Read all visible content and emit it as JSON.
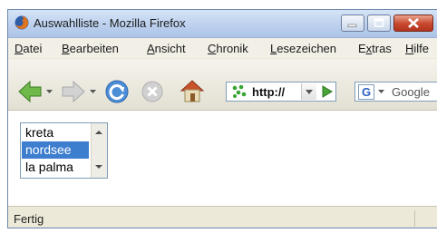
{
  "window": {
    "title": "Auswahlliste - Mozilla Firefox"
  },
  "menu": {
    "items": [
      {
        "pre": "",
        "acc": "D",
        "post": "atei"
      },
      {
        "pre": "",
        "acc": "B",
        "post": "earbeiten"
      },
      {
        "pre": "",
        "acc": "A",
        "post": "nsicht"
      },
      {
        "pre": "",
        "acc": "C",
        "post": "hronik"
      },
      {
        "pre": "",
        "acc": "L",
        "post": "esezeichen"
      },
      {
        "pre": "E",
        "acc": "x",
        "post": "tras"
      },
      {
        "pre": "",
        "acc": "H",
        "post": "ilfe"
      }
    ]
  },
  "toolbar": {
    "url_text": "http://",
    "search_placeholder": "Google"
  },
  "listbox": {
    "options": [
      "kreta",
      "nordsee",
      "la palma"
    ],
    "selected_index": 1
  },
  "status": {
    "text": "Fertig"
  },
  "icons": {
    "title": "firefox-icon",
    "back": "back-arrow-icon",
    "forward": "forward-arrow-icon",
    "reload": "reload-icon",
    "stop": "stop-icon",
    "home": "home-icon",
    "site": "site-identity-icon",
    "go": "go-arrow-icon",
    "search_engine": "google-icon"
  },
  "colors": {
    "selection": "#3d7ecf",
    "titlebar": "#bdd1ee",
    "chrome": "#ece9d8"
  }
}
